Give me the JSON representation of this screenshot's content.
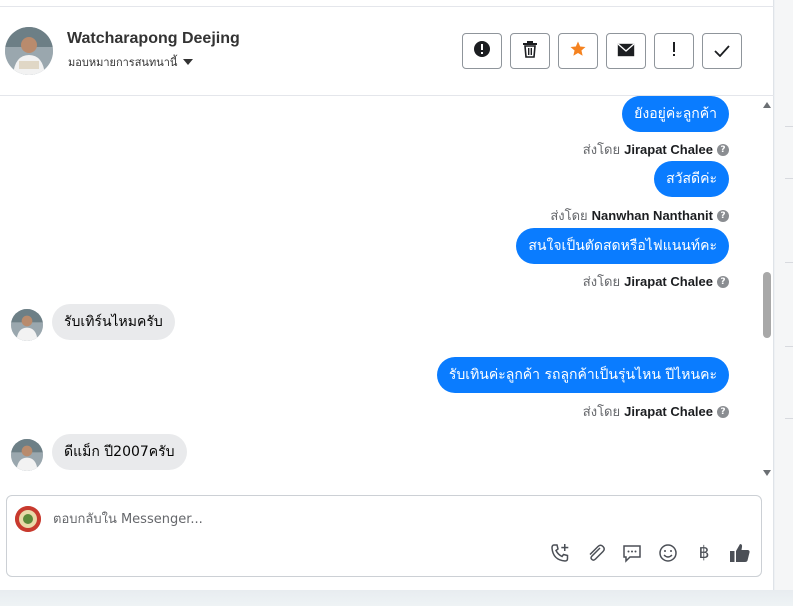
{
  "header": {
    "contact_name": "Watcharapong Deejing",
    "assign_label": "มอบหมายการสนทนานี้"
  },
  "toolbar": [
    {
      "name": "spam-button",
      "icon": "exclamation-circle-icon",
      "glyph": "⬤"
    },
    {
      "name": "delete-button",
      "icon": "trash-icon",
      "glyph": "🗑"
    },
    {
      "name": "star-button",
      "icon": "star-icon",
      "glyph": "★"
    },
    {
      "name": "mark-unread-button",
      "icon": "envelope-icon",
      "glyph": "✉"
    },
    {
      "name": "follow-up-button",
      "icon": "exclamation-icon",
      "glyph": "!"
    },
    {
      "name": "mark-done-button",
      "icon": "check-icon",
      "glyph": "✓"
    }
  ],
  "messages": [
    {
      "dir": "out",
      "text": "ยังอยู่ค่ะลูกค้า"
    },
    {
      "dir": "sent_by",
      "prefix": "ส่งโดย",
      "sender": "Jirapat Chalee"
    },
    {
      "dir": "out",
      "text": "สวัสดีค่ะ"
    },
    {
      "dir": "sent_by",
      "prefix": "ส่งโดย",
      "sender": "Nanwhan Nanthanit"
    },
    {
      "dir": "out",
      "text": "สนใจเป็นตัดสดหรือไฟแนนท์คะ"
    },
    {
      "dir": "sent_by",
      "prefix": "ส่งโดย",
      "sender": "Jirapat Chalee"
    },
    {
      "dir": "in",
      "text": "รับเทิร์นไหมครับ"
    },
    {
      "dir": "out",
      "text": "รับเทินค่ะลูกค้า รถลูกค้าเป็นรุ่นไหน ปีไหนคะ"
    },
    {
      "dir": "sent_by",
      "prefix": "ส่งโดย",
      "sender": "Jirapat Chalee"
    },
    {
      "dir": "in",
      "text": "ดีแม็ก ปี2007ครับ"
    }
  ],
  "composer": {
    "placeholder": "ตอบกลับใน Messenger...",
    "icons": [
      {
        "name": "call-add-icon",
        "glyph": "✆"
      },
      {
        "name": "attachment-icon",
        "glyph": "📎"
      },
      {
        "name": "saved-replies-icon",
        "glyph": "💬"
      },
      {
        "name": "emoji-icon",
        "glyph": "☺"
      },
      {
        "name": "baht-payment-icon",
        "glyph": "฿"
      },
      {
        "name": "like-icon",
        "glyph": "👍"
      }
    ]
  },
  "colors": {
    "outgoing_bubble": "#0a7cff",
    "incoming_bubble": "#e9eaec",
    "star": "#f5821f"
  }
}
